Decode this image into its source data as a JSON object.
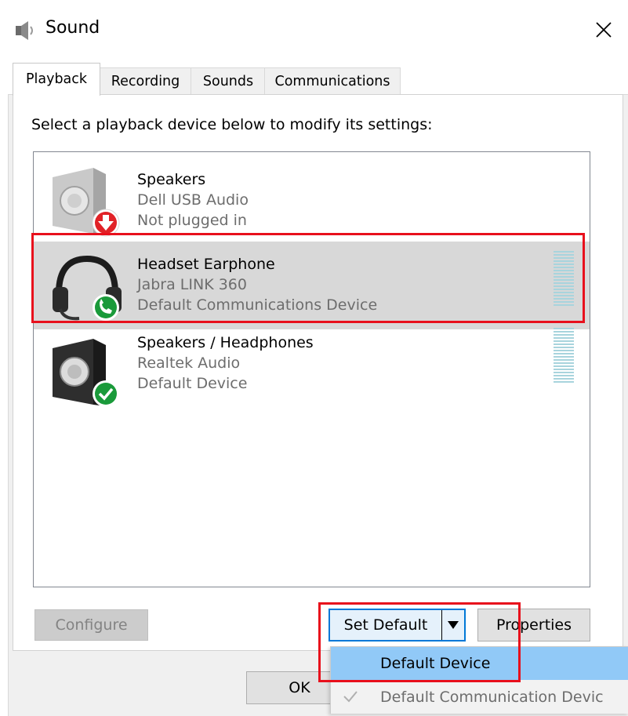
{
  "window": {
    "title": "Sound",
    "icon": "speaker-icon",
    "close_icon": "close-icon"
  },
  "tabs": [
    {
      "label": "Playback",
      "active": true
    },
    {
      "label": "Recording",
      "active": false
    },
    {
      "label": "Sounds",
      "active": false
    },
    {
      "label": "Communications",
      "active": false
    }
  ],
  "instruction": "Select a playback device below to modify its settings:",
  "devices": [
    {
      "name": "Speakers",
      "driver": "Dell USB Audio",
      "status": "Not plugged in",
      "icon": "speaker-icon",
      "badge": "red-down-arrow-icon",
      "selected": false,
      "level_meter": false
    },
    {
      "name": "Headset Earphone",
      "driver": "Jabra LINK 360",
      "status": "Default Communications Device",
      "icon": "headset-icon",
      "badge": "green-phone-icon",
      "selected": true,
      "level_meter": true
    },
    {
      "name": "Speakers / Headphones",
      "driver": "Realtek Audio",
      "status": "Default Device",
      "icon": "speaker-icon",
      "badge": "green-check-icon",
      "selected": false,
      "level_meter": true
    }
  ],
  "buttons": {
    "configure": "Configure",
    "set_default": "Set Default",
    "properties": "Properties",
    "ok": "OK"
  },
  "dropdown": {
    "items": [
      {
        "label": "Default Device",
        "highlighted": true,
        "checked": false
      },
      {
        "label": "Default Communication Devic",
        "highlighted": false,
        "checked": true
      }
    ]
  },
  "colors": {
    "annotation_red": "#e8101c",
    "selection_gray": "#d8d8d8",
    "menu_hover": "#91c9f7",
    "focus_blue": "#0078d7"
  }
}
